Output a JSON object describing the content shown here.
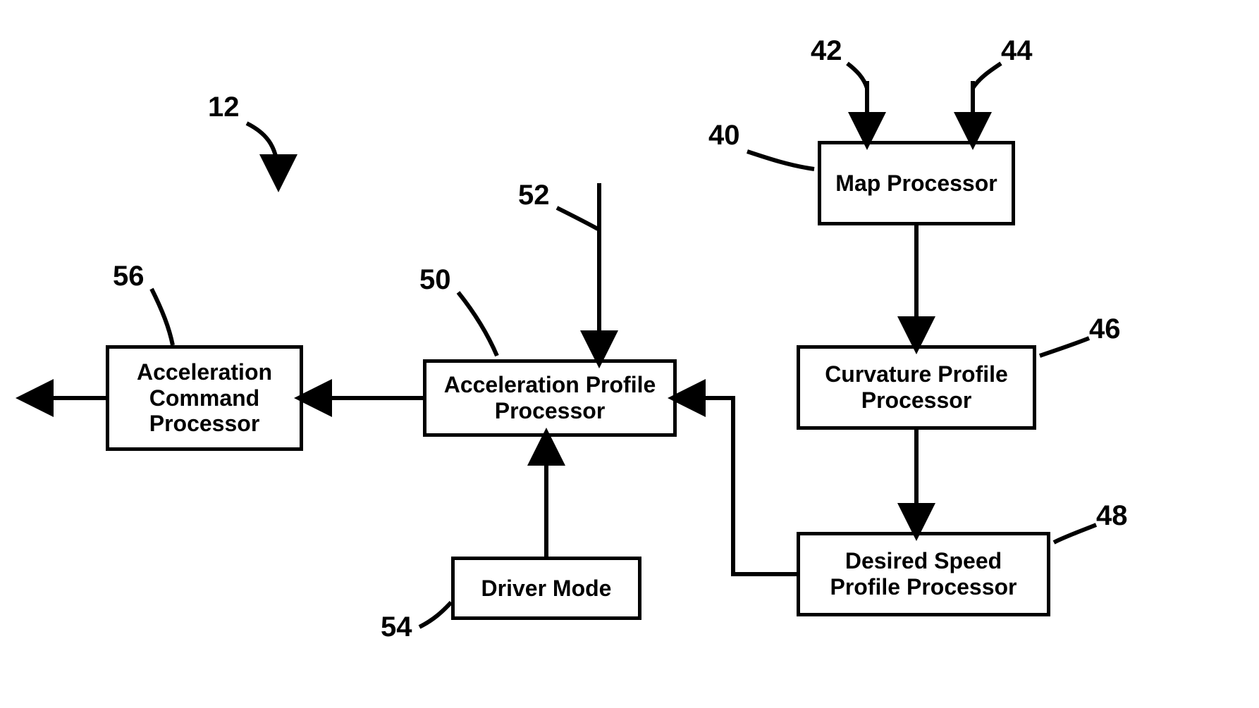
{
  "labels": {
    "l12": "12",
    "l40": "40",
    "l42": "42",
    "l44": "44",
    "l46": "46",
    "l48": "48",
    "l50": "50",
    "l52": "52",
    "l54": "54",
    "l56": "56"
  },
  "boxes": {
    "map_processor": "Map Processor",
    "curvature_profile_processor": "Curvature Profile Processor",
    "desired_speed_profile_processor": "Desired Speed Profile Processor",
    "acceleration_profile_processor": "Acceleration Profile Processor",
    "driver_mode": "Driver Mode",
    "acceleration_command_processor": "Acceleration Command Processor"
  }
}
